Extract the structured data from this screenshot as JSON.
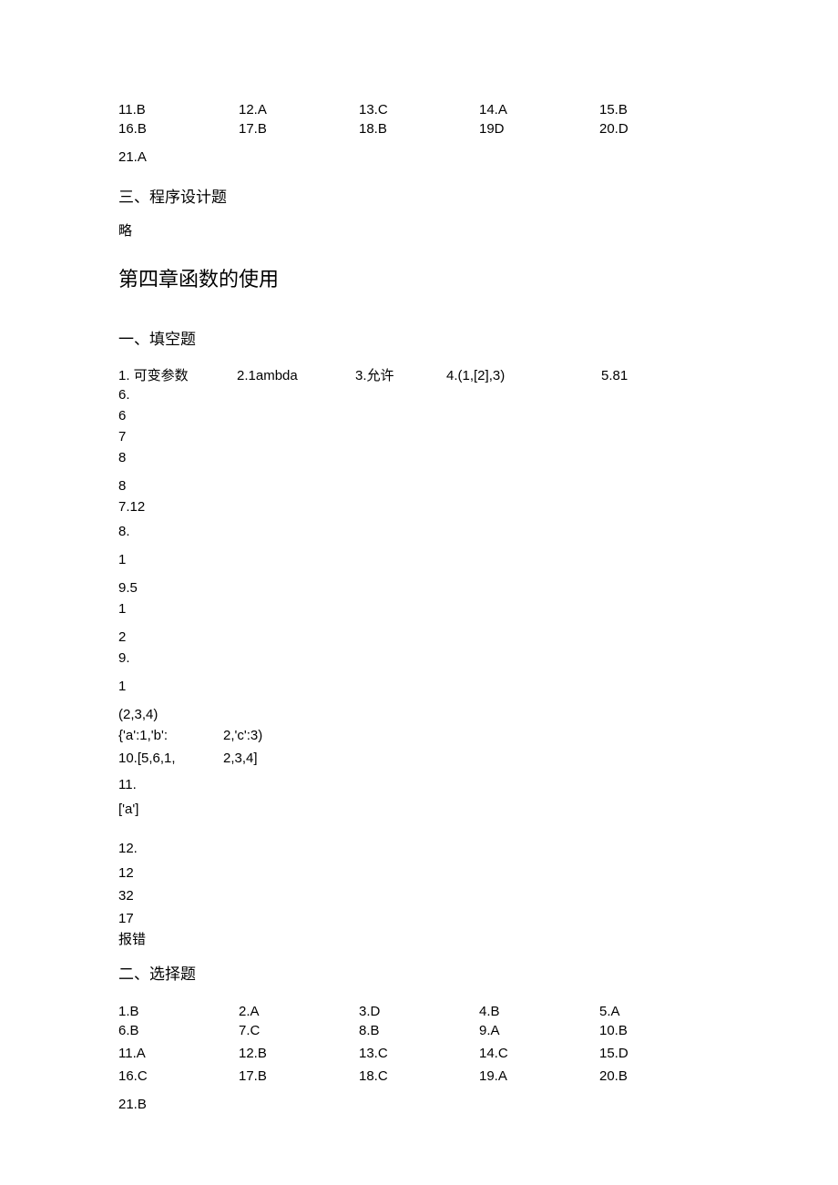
{
  "top_answers_row1": [
    "11.B",
    "12.A",
    "13.C",
    "14.A",
    "15.B"
  ],
  "top_answers_row2": [
    "16.B",
    "17.B",
    "18.B",
    "19D",
    "20.D"
  ],
  "top_answer_last": "21.A",
  "section3_title": "三、程序设计题",
  "section3_body": "略",
  "chapter_title": "第四章函数的使用",
  "fill_heading": "一、填空题",
  "fill_row1": {
    "c1": "1. 可变参数",
    "c2": "2.1ambda",
    "c3": "3.允许",
    "c4": "4.(1,[2],3)",
    "c5": "5.81"
  },
  "fill_lines": {
    "l6_label": "6.",
    "l6a": "6",
    "l6b": "7",
    "l6c": "8",
    "l6d": "8",
    "l7": "7.12",
    "l8_label": "8.",
    "l8a": "1",
    "l9label": "9.5",
    "l9a": "1",
    "l9b": "2",
    "l9c": "9.",
    "l9d": "1",
    "l_tuple": "(2,3,4)",
    "l_dict_a": "{'a':1,'b':",
    "l_dict_b": "2,'c':3)",
    "l10a": "10.[5,6,1,",
    "l10b": "2,3,4]",
    "l11_label": "11.",
    "l11a": "['a']",
    "l12_label": "12.",
    "l12a": "12",
    "l12b": "32",
    "l12c": "17",
    "l12d": "报错"
  },
  "choice_heading": "二、选择题",
  "choice_rows": [
    [
      "1.B",
      "2.A",
      "3.D",
      "4.B",
      "5.A"
    ],
    [
      "6.B",
      "7.C",
      "8.B",
      "9.A",
      "10.B"
    ],
    [
      "11.A",
      "12.B",
      "13.C",
      "14.C",
      "15.D"
    ],
    [
      "16.C",
      "17.B",
      "18.C",
      "19.A",
      "20.B"
    ]
  ],
  "choice_last": "21.B"
}
